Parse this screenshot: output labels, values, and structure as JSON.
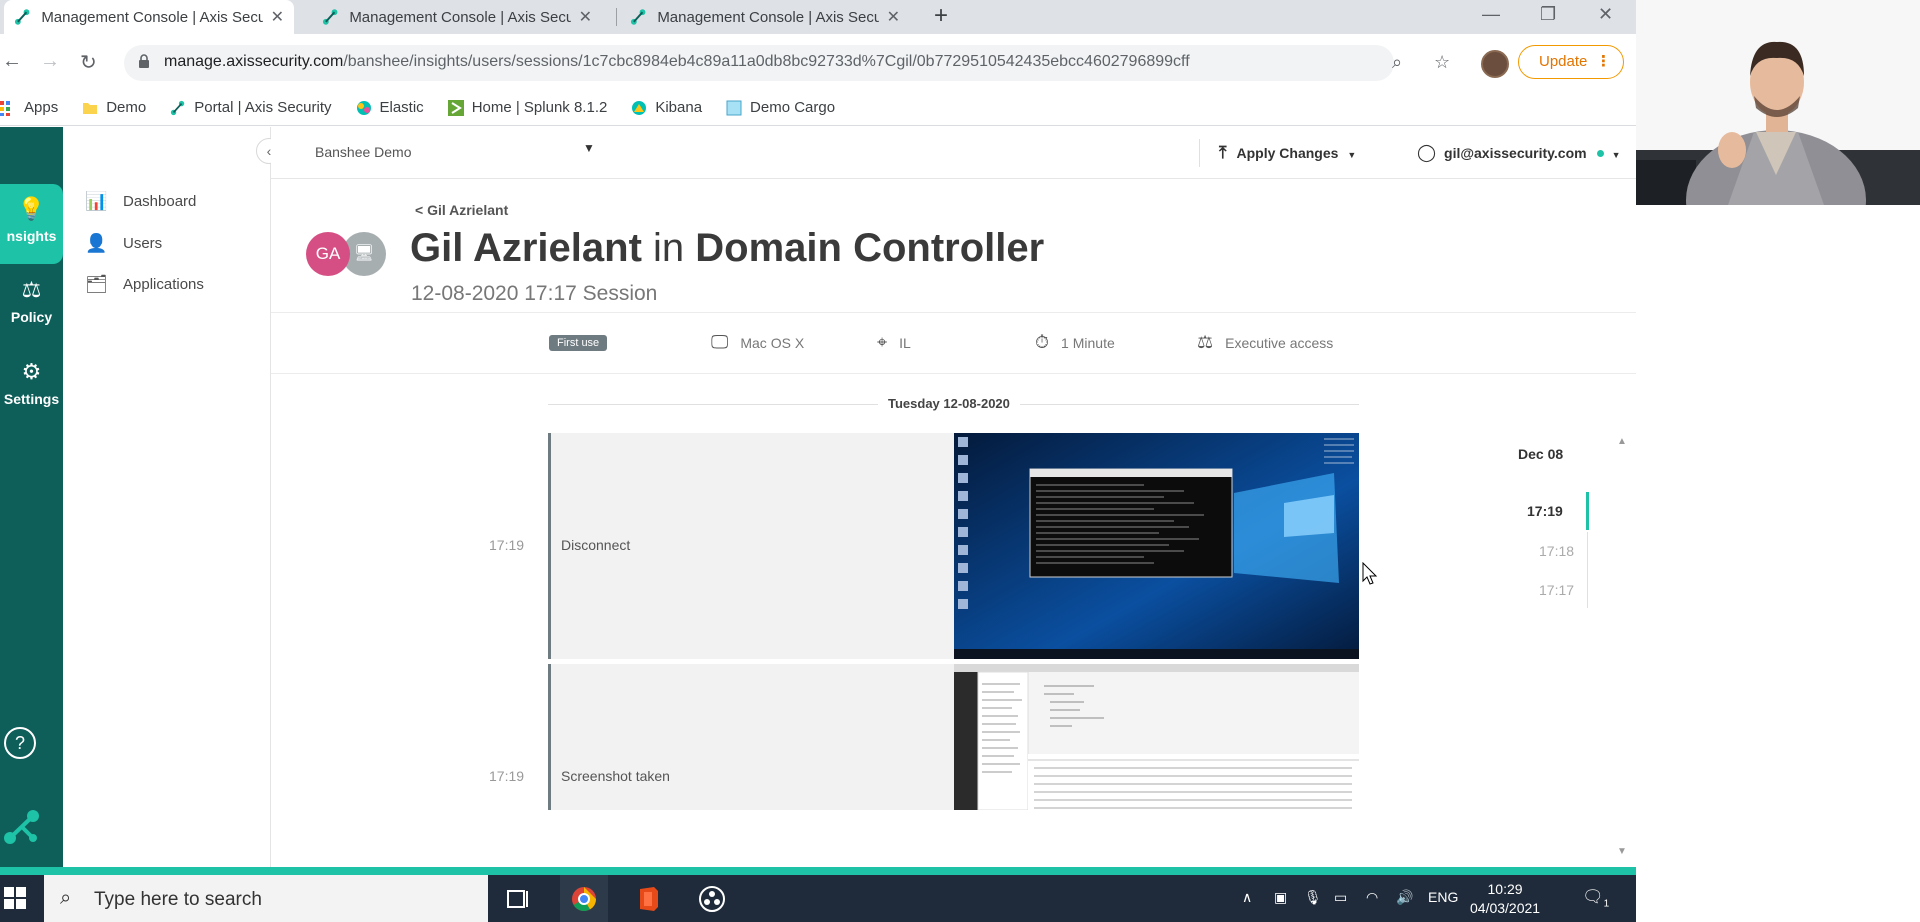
{
  "browser": {
    "tabs": [
      {
        "title": "Management Console | Axis Secu"
      },
      {
        "title": "Management Console | Axis Secu"
      },
      {
        "title": "Management Console | Axis Secu"
      }
    ],
    "url_host": "manage.axissecurity.com",
    "url_path": "/banshee/insights/users/sessions/1c7cbc8984eb4c89a11a0db8bc92733d%7Cgil/0b7729510542435ebcc4602796899cff",
    "update_label": "Update",
    "bookmarks": [
      {
        "label": "Apps"
      },
      {
        "label": "Demo"
      },
      {
        "label": "Portal | Axis Security"
      },
      {
        "label": "Elastic"
      },
      {
        "label": "Home | Splunk 8.1.2"
      },
      {
        "label": "Kibana"
      },
      {
        "label": "Demo Cargo"
      }
    ]
  },
  "rail": {
    "items": [
      {
        "label": "nsights",
        "icon": "lightbulb-icon"
      },
      {
        "label": "Policy",
        "icon": "gavel-icon"
      },
      {
        "label": "Settings",
        "icon": "gear-icon"
      }
    ]
  },
  "subnav": {
    "items": [
      {
        "label": "Dashboard",
        "icon": "bar-chart-icon"
      },
      {
        "label": "Users",
        "icon": "user-icon"
      },
      {
        "label": "Applications",
        "icon": "apps-icon"
      }
    ]
  },
  "header": {
    "environment": "Banshee Demo",
    "apply_label": "Apply Changes",
    "user_email": "gil@axissecurity.com"
  },
  "session": {
    "back_label": "< Gil Azrielant",
    "avatar_initials": "GA",
    "user_name": "Gil Azrielant",
    "connector": "in",
    "resource": "Domain Controller",
    "subtitle": "12-08-2020 17:17 Session",
    "badge": "First use",
    "os": "Mac OS X",
    "location": "IL",
    "duration": "1 Minute",
    "access": "Executive access"
  },
  "timeline": {
    "date_label": "Tuesday 12-08-2020",
    "events": [
      {
        "time": "17:19",
        "label": "Disconnect"
      },
      {
        "time": "17:19",
        "label": "Screenshot taken"
      }
    ],
    "month_label": "Dec 08",
    "ticks": [
      "17:19",
      "17:18",
      "17:17"
    ]
  },
  "taskbar": {
    "search_placeholder": "Type here to search",
    "language": "ENG",
    "time": "10:29",
    "date": "04/03/2021",
    "notif_count": "1"
  },
  "colors": {
    "rail": "#0e5f5a",
    "accent": "#1ec2a6",
    "avatar": "#d64f84"
  }
}
